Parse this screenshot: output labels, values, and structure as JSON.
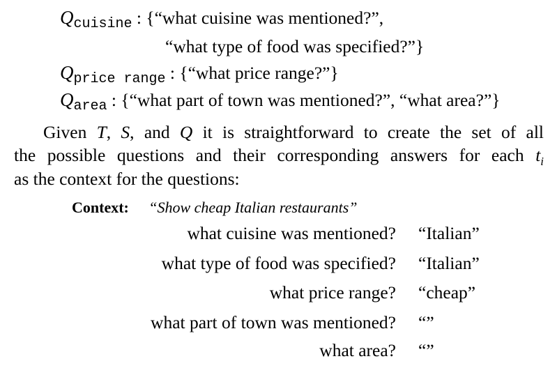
{
  "definitions": [
    {
      "symbol": "Q",
      "subscript": "cuisine",
      "line1": ": {“what cuisine was mentioned?”,",
      "line2": "“what type of food was specified?”}"
    },
    {
      "symbol": "Q",
      "subscript": "price range",
      "line1": ": {“what price range?”}"
    },
    {
      "symbol": "Q",
      "subscript": "area",
      "line1": ": {“what part of town was mentioned?”, “what area?”}"
    }
  ],
  "paragraph": {
    "line1_pre": "Given",
    "T": "T",
    "comma1": ",",
    "S": "S",
    "and": ", and",
    "Q": "Q",
    "line1_post": "it is straightforward to create the set of all",
    "line2_pre": "the possible questions and their corresponding answers for each",
    "t": "t",
    "i": "i",
    "line3": "as the context for the questions:"
  },
  "example": {
    "context_label": "Context:",
    "context_text": "“Show cheap Italian restaurants”",
    "pairs": [
      {
        "question": "what cuisine was mentioned?",
        "answer": "“Italian”"
      },
      {
        "question": "what type of food was specified?",
        "answer": "“Italian”"
      },
      {
        "question": "what price range?",
        "answer": "“cheap”"
      },
      {
        "question": "what part of town was mentioned?",
        "answer": "“”"
      },
      {
        "question": "what area?",
        "answer": "“”"
      }
    ]
  }
}
